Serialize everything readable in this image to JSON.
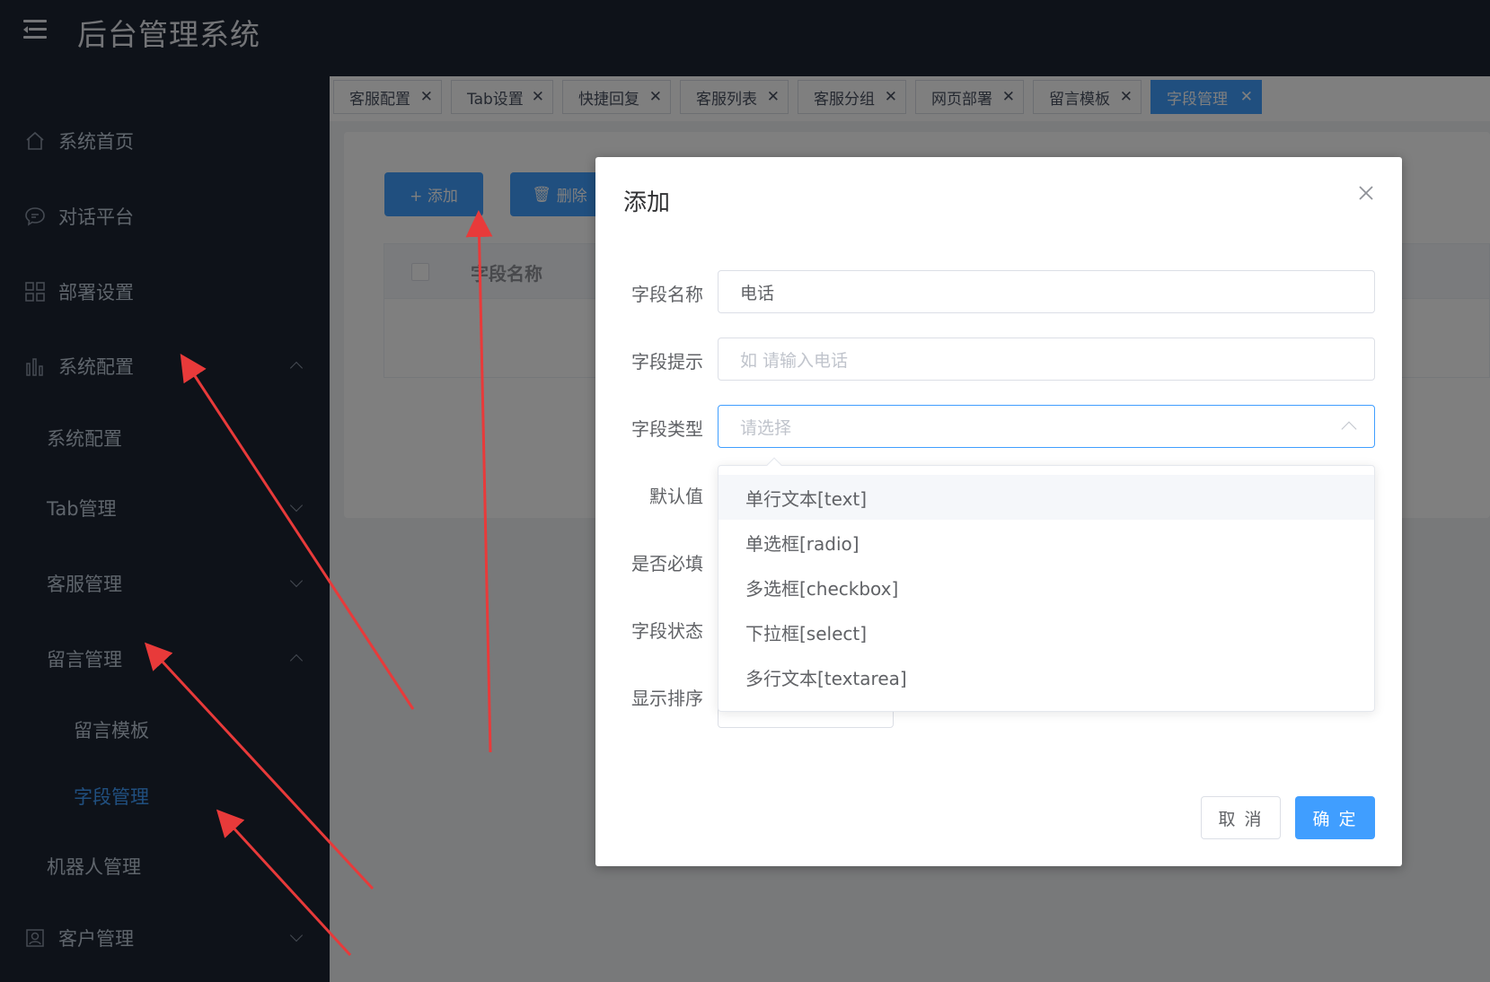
{
  "app": {
    "title": "后台管理系统"
  },
  "sidebar": {
    "items": [
      {
        "label": "系统首页",
        "icon": "home-icon"
      },
      {
        "label": "对话平台",
        "icon": "chat-icon"
      },
      {
        "label": "部署设置",
        "icon": "grid-icon"
      },
      {
        "label": "系统配置",
        "icon": "bar-chart-icon",
        "expanded": true
      }
    ],
    "sub_items": {
      "sys_config": "系统配置",
      "tab_manage": "Tab管理",
      "service_manage": "客服管理",
      "message_manage": "留言管理",
      "message_template": "留言模板",
      "field_manage": "字段管理",
      "robot_manage": "机器人管理"
    },
    "customer": {
      "label": "客户管理",
      "icon": "user-card-icon"
    }
  },
  "tabs": [
    {
      "label": "客服配置"
    },
    {
      "label": "Tab设置"
    },
    {
      "label": "快捷回复"
    },
    {
      "label": "客服列表"
    },
    {
      "label": "客服分组"
    },
    {
      "label": "网页部署"
    },
    {
      "label": "留言模板"
    },
    {
      "label": "字段管理",
      "active": true
    }
  ],
  "toolbar": {
    "add_label": "+ 添加",
    "delete_label": "删除"
  },
  "table": {
    "header_name": "字段名称"
  },
  "dialog": {
    "title": "添加",
    "fields": {
      "name_label": "字段名称",
      "name_value": "电话",
      "hint_label": "字段提示",
      "hint_placeholder": "如 请输入电话",
      "type_label": "字段类型",
      "type_placeholder": "请选择",
      "default_label": "默认值",
      "required_label": "是否必填",
      "status_label": "字段状态",
      "order_label": "显示排序"
    },
    "type_options": [
      "单行文本[text]",
      "单选框[radio]",
      "多选框[checkbox]",
      "下拉框[select]",
      "多行文本[textarea]"
    ],
    "cancel_label": "取 消",
    "ok_label": "确 定"
  },
  "colors": {
    "accent": "#409eff",
    "sidebar_bg": "#1d2533",
    "annotation_arrow": "#e83a3a"
  }
}
